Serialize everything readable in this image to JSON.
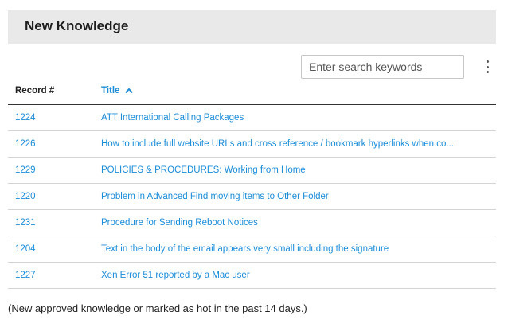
{
  "header": {
    "title": "New Knowledge"
  },
  "search": {
    "placeholder": "Enter search keywords",
    "value": ""
  },
  "toolbar": {
    "more_icon": "vertical-dots-icon"
  },
  "table": {
    "columns": {
      "record": "Record #",
      "title": "Title",
      "sort": "ascending"
    },
    "rows": [
      {
        "record": "1224",
        "title": "ATT International Calling Packages"
      },
      {
        "record": "1226",
        "title": "How to include full website URLs and cross reference / bookmark hyperlinks when co..."
      },
      {
        "record": "1229",
        "title": "POLICIES & PROCEDURES: Working from Home"
      },
      {
        "record": "1220",
        "title": "Problem in Advanced Find moving items to Other Folder"
      },
      {
        "record": "1231",
        "title": "Procedure for Sending Reboot Notices"
      },
      {
        "record": "1204",
        "title": "Text in the body of the email appears very small including the signature"
      },
      {
        "record": "1227",
        "title": "Xen Error 51 reported by a Mac user"
      }
    ]
  },
  "footer": {
    "note": "(New approved knowledge or marked as hot in the past 14 days.)"
  },
  "colors": {
    "link": "#1a8cd8",
    "header_bg": "#e9e9e9"
  }
}
